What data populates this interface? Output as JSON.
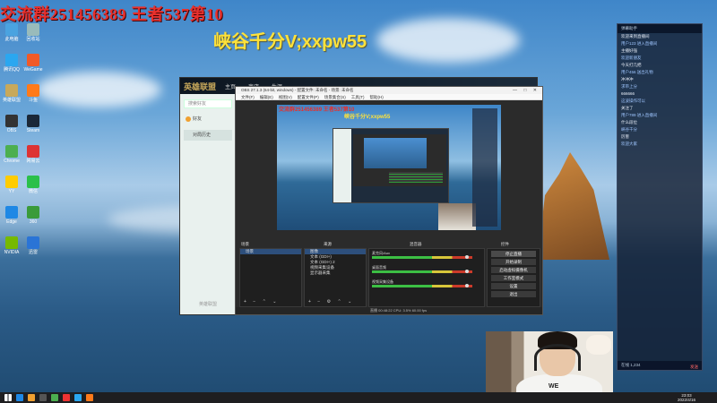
{
  "overlay": {
    "red_text": "交流群251456389 王者537第10",
    "yellow_text": "峡谷千分V;xxpw55"
  },
  "desktop_icons": [
    {
      "name": "此电脑",
      "color": "#4aa3e0"
    },
    {
      "name": "回收站",
      "color": "#9bb"
    },
    {
      "name": "腾讯QQ",
      "color": "#2aa7f0"
    },
    {
      "name": "WeGame",
      "color": "#f05a28"
    },
    {
      "name": "英雄联盟",
      "color": "#c8a95b"
    },
    {
      "name": "斗鱼",
      "color": "#ff7a1a"
    },
    {
      "name": "OBS",
      "color": "#333"
    },
    {
      "name": "Steam",
      "color": "#1b2838"
    },
    {
      "name": "Chrome",
      "color": "#4caf50"
    },
    {
      "name": "网易云",
      "color": "#d33"
    },
    {
      "name": "YY",
      "color": "#ffcc00"
    },
    {
      "name": "微信",
      "color": "#2ac04a"
    },
    {
      "name": "Edge",
      "color": "#1e88e5"
    },
    {
      "name": "360",
      "color": "#3a9b3a"
    },
    {
      "name": "NVIDIA",
      "color": "#76b900"
    },
    {
      "name": "迅雷",
      "color": "#2a74d6"
    }
  ],
  "lol_client": {
    "logo": "英雄联盟",
    "tabs": [
      "主页",
      "商店",
      "生涯"
    ],
    "search_placeholder": "搜索好友",
    "sidebar_items": [
      "好友",
      "对局历史"
    ],
    "footer": "英雄联盟"
  },
  "obs": {
    "title": "OBS 27.1.3 (64-bit, windows) - 配置文件: 未命名 - 场景: 未命名",
    "menu": [
      "文件(F)",
      "编辑(E)",
      "视图(V)",
      "配置文件(P)",
      "场景集合(S)",
      "工具(T)",
      "帮助(H)"
    ],
    "preview_red": "交流群251456389 王者537第10",
    "preview_yellow": "峡谷千分V;xxpw55",
    "docks": {
      "scenes_header": "场景",
      "sources_header": "来源",
      "mixer_header": "混音器",
      "controls_header": "控件",
      "scenes": [
        "场景"
      ],
      "sources": [
        "图像",
        "文本 (GDI+)",
        "文本 (GDI+) 2",
        "视频采集设备",
        "显示器采集"
      ],
      "mixer_channels": [
        "麦克风/Aux",
        "桌面音频",
        "视频采集设备"
      ],
      "controls": [
        "停止直播",
        "开始录制",
        "启动虚拟摄像机",
        "工作室模式",
        "设置",
        "退出"
      ],
      "status": "直播 00:48:22  CPU: 3.5%  60.00 fps"
    }
  },
  "chat": {
    "header": "弹幕助手",
    "messages": [
      {
        "text": "欢迎来到直播间",
        "style": "w"
      },
      {
        "text": "用户123 进入直播间",
        "style": "b"
      },
      {
        "text": "主播好强",
        "style": "w"
      },
      {
        "text": "欢迎新朋友",
        "style": "b"
      },
      {
        "text": "今天打几把",
        "style": "w"
      },
      {
        "text": "用户456 送出礼物",
        "style": "b"
      },
      {
        "text": "冲冲冲",
        "style": "w"
      },
      {
        "text": "求带上分",
        "style": "b"
      },
      {
        "text": "666666",
        "style": "w"
      },
      {
        "text": "这波操作可以",
        "style": "b"
      },
      {
        "text": "关注了",
        "style": "w"
      },
      {
        "text": "用户789 进入直播间",
        "style": "b"
      },
      {
        "text": "什么段位",
        "style": "w"
      },
      {
        "text": "峡谷千分",
        "style": "b"
      },
      {
        "text": "厉害",
        "style": "w"
      },
      {
        "text": "欢迎大家",
        "style": "b"
      }
    ],
    "footer": "在线 1,234",
    "send_label": "发送"
  },
  "webcam": {
    "shirt_print": "WE"
  },
  "taskbar": {
    "time": "23:03",
    "date": "2022/4/16",
    "icons": [
      "#1e88e5",
      "#f0a030",
      "#555",
      "#4caf50",
      "#e33",
      "#2aa7f0",
      "#ff7a1a"
    ]
  }
}
